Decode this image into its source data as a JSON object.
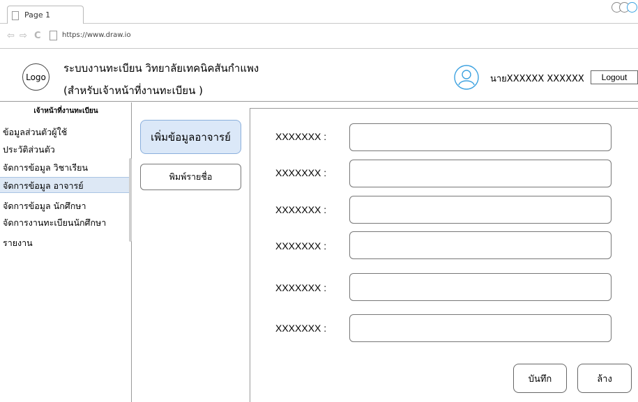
{
  "browser": {
    "tab_title": "Page 1",
    "url": "https://www.draw.io"
  },
  "header": {
    "logo_text": "Logo",
    "title_line1": "ระบบงานทะเบียน วิทยาลัยเทคนิคสันกำแพง",
    "title_line2": "(สำหรับเจ้าหน้าที่งานทะเบียน )",
    "user_name": "นายXXXXXX XXXXXX",
    "logout_label": "Logout"
  },
  "sidebar": {
    "heading": "เจ้าหน้าที่งานทะเบียน",
    "items": [
      {
        "label": "ข้อมูลส่วนตัวผู้ใช้"
      },
      {
        "label": "ประวัติส่วนตัว"
      },
      {
        "label": "จัดการข้อมูล วิชาเรียน"
      },
      {
        "label": "จัดการข้อมูล อาจารย์"
      },
      {
        "label": "จัดการข้อมูล นักศึกษา"
      },
      {
        "label": "จัดการงานทะเบียนนักศึกษา"
      },
      {
        "label": "รายงาน"
      }
    ],
    "active_index": 3
  },
  "submenu": {
    "add_label": "เพิ่มข้อมูลอาจารย์",
    "print_label": "พิมพ์รายชื่อ"
  },
  "form": {
    "fields": [
      {
        "label": "XXXXXXX :",
        "value": ""
      },
      {
        "label": "XXXXXXX :",
        "value": ""
      },
      {
        "label": "XXXXXXX :",
        "value": ""
      },
      {
        "label": "XXXXXXX :",
        "value": ""
      },
      {
        "label": "XXXXXXX :",
        "value": ""
      },
      {
        "label": "XXXXXXX :",
        "value": ""
      }
    ],
    "save_label": "บันทึก",
    "clear_label": "ล้าง"
  },
  "colors": {
    "active_bg": "#dde8f5",
    "accent_blue": "#3ba1e0",
    "button_highlight": "#dbe8f8"
  },
  "icons": {
    "back": "arrow-left-icon",
    "forward": "arrow-right-icon",
    "reload": "reload-icon",
    "page": "page-icon",
    "user": "user-avatar-icon"
  }
}
